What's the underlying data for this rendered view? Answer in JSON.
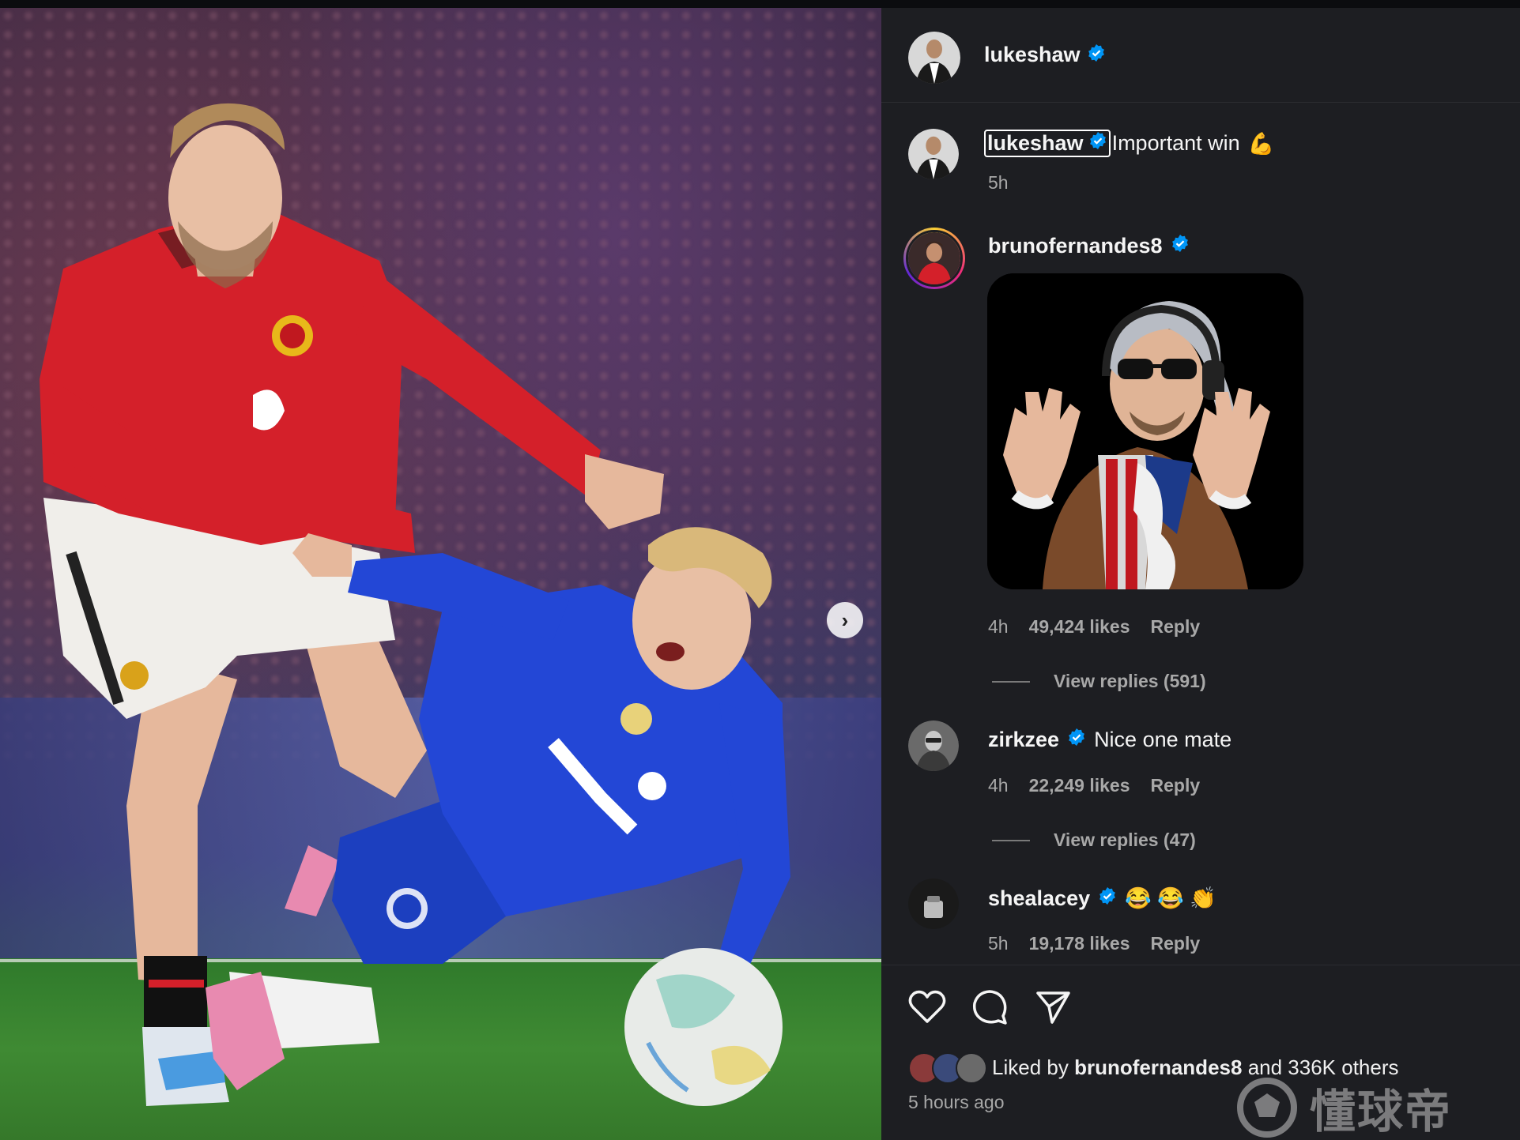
{
  "post": {
    "author": "lukeshaw",
    "caption_user": "lukeshaw",
    "caption_text": "Important win",
    "caption_emoji": "💪",
    "caption_time": "5h"
  },
  "comments": [
    {
      "user": "brunofernandes8",
      "time": "4h",
      "likes": "49,424 likes",
      "reply_label": "Reply",
      "view_replies": "View replies (591)",
      "has_gif": true
    },
    {
      "user": "zirkzee",
      "text": "Nice one mate",
      "time": "4h",
      "likes": "22,249 likes",
      "reply_label": "Reply",
      "view_replies": "View replies (47)"
    },
    {
      "user": "shealacey",
      "text": "😂 😂 👏",
      "time": "5h",
      "likes": "19,178 likes",
      "reply_label": "Reply"
    }
  ],
  "footer": {
    "liked_prefix": "Liked by",
    "liked_user": "brunofernandes8",
    "liked_suffix": "and 336K others",
    "time_ago": "5 hours ago"
  },
  "watermark": {
    "text": "懂球帝"
  },
  "icons": {
    "verified": "verified-badge-icon",
    "like": "heart-icon",
    "comment": "comment-icon",
    "share": "send-icon",
    "next": "chevron-right-icon"
  },
  "colors": {
    "panel_bg": "#1d1e22",
    "verified_blue": "#0095f6",
    "muted_text": "#a8a8a8",
    "united_red": "#d4202a",
    "chelsea_blue": "#1c3fbf"
  }
}
